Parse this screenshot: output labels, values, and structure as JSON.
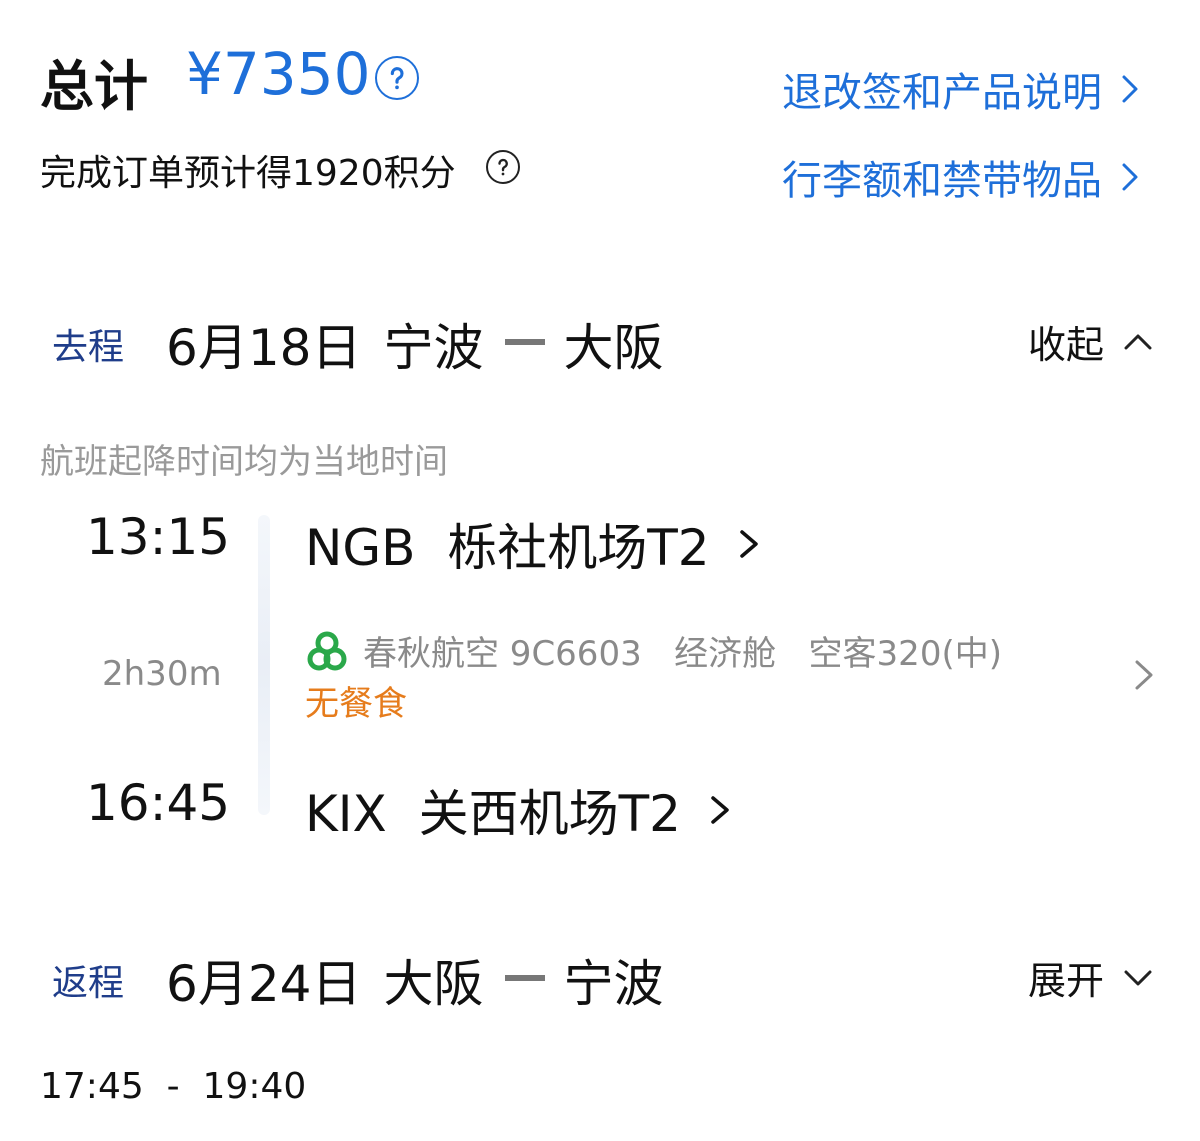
{
  "summary": {
    "total_label": "总计",
    "total_price": "¥7350",
    "points_text": "完成订单预计得1920积分"
  },
  "links": {
    "refund_rules": "退改签和产品说明",
    "baggage_rules": "行李额和禁带物品"
  },
  "outbound": {
    "label": "去程",
    "date": "6月18日",
    "from": "宁波",
    "to": "大阪",
    "toggle": "收起",
    "local_time_note": "航班起降时间均为当地时间",
    "depart_time": "13:15",
    "depart_airport": "NGB  栎社机场T2",
    "duration": "2h30m",
    "flight_info": "春秋航空 9C6603   经济舱   空客320(中)",
    "meal": "无餐食",
    "arrive_time": "16:45",
    "arrive_airport": "KIX  关西机场T2"
  },
  "return": {
    "label": "返程",
    "date": "6月24日",
    "from": "大阪",
    "to": "宁波",
    "toggle": "展开",
    "time_range": "17:45  -  19:40"
  },
  "colors": {
    "accent_blue": "#1e6fd9",
    "leg_label": "#1f3d8a",
    "meal_orange": "#e67c1c",
    "airline_green": "#2aa84a"
  },
  "icons": [
    "help-circle-icon",
    "chevron-right-icon",
    "chevron-up-icon",
    "chevron-down-icon",
    "airline-logo-icon"
  ]
}
